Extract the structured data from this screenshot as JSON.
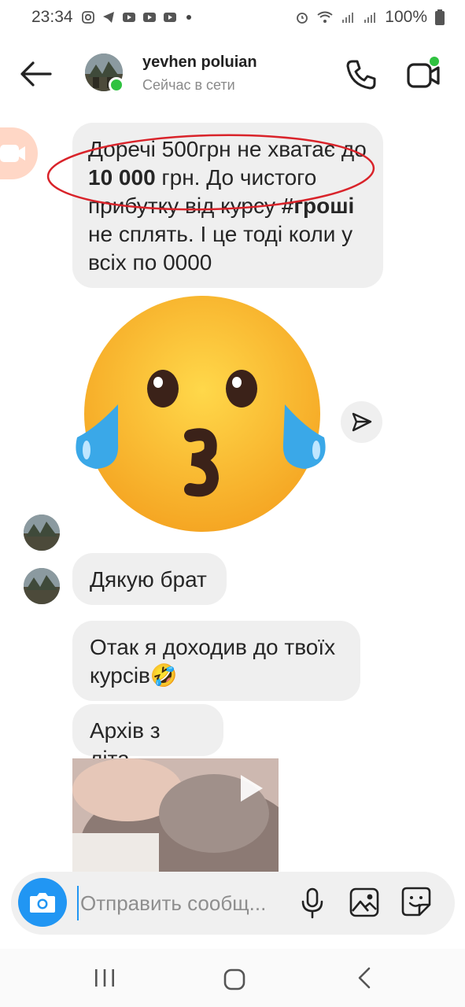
{
  "status_bar": {
    "time": "23:34",
    "battery": "100%"
  },
  "header": {
    "username": "yevhen poluian",
    "status": "Сейчас в сети"
  },
  "messages": [
    {
      "id": "m1",
      "sender": "self",
      "parts": [
        {
          "text": "Доречі 500грн не хватає до ",
          "bold": false
        },
        {
          "text": "10 000",
          "bold": true
        },
        {
          "text": " грн. До чистого прибутку від курсу ",
          "bold": false
        },
        {
          "text": "#гроші",
          "bold": true
        },
        {
          "text": " не сплять. І це тоді коли у всіх по 0000",
          "bold": false
        }
      ]
    },
    {
      "id": "m2",
      "sender": "yevhen poluian",
      "text": "Дякую брат"
    },
    {
      "id": "m3",
      "sender": "self",
      "text": "Отак я доходив до твоїх курсів🤣"
    },
    {
      "id": "m4",
      "sender": "self",
      "text": "Архів з літа"
    }
  ],
  "composer": {
    "placeholder": "Отправить сообщ..."
  },
  "colors": {
    "accent": "#2196f3",
    "online": "#2fc240",
    "bubble": "#efefef",
    "annotation": "#d9232a"
  },
  "icons": [
    "back-arrow-icon",
    "phone-icon",
    "video-call-icon",
    "camera-icon",
    "mic-icon",
    "gallery-icon",
    "sticker-icon",
    "share-send-icon",
    "play-icon"
  ]
}
